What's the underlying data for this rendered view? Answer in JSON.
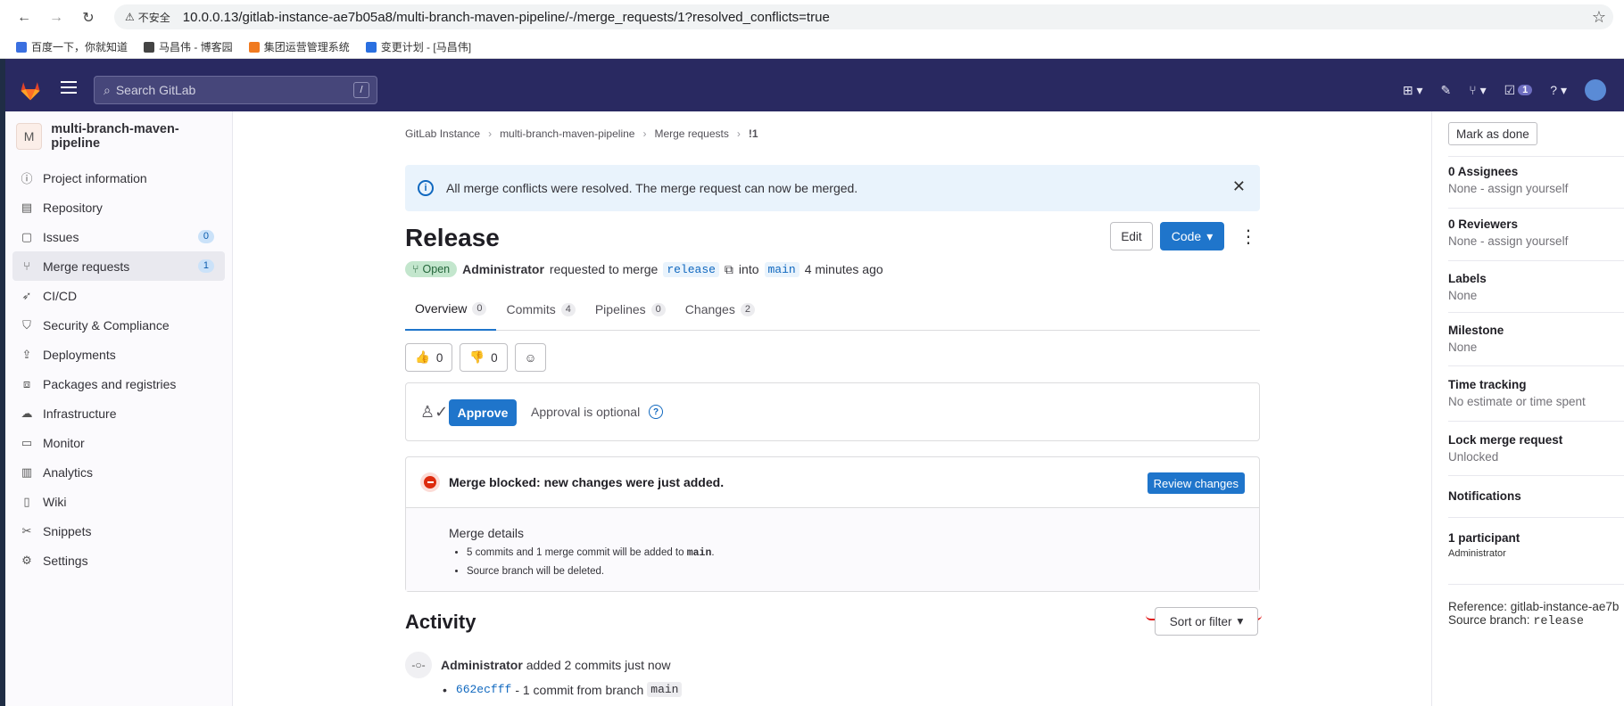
{
  "browser": {
    "insecure_label": "不安全",
    "url": "10.0.0.13/gitlab-instance-ae7b05a8/multi-branch-maven-pipeline/-/merge_requests/1?resolved_conflicts=true",
    "bookmarks": [
      "百度一下，你就知道",
      "马昌伟 - 博客园",
      "集团运营管理系统",
      "变更计划 - [马昌伟]"
    ]
  },
  "topbar": {
    "search_placeholder": "Search GitLab",
    "search_shortcut": "/",
    "todo_count": "1"
  },
  "sidebar": {
    "project_avatar": "M",
    "project_name": "multi-branch-maven-pipeline",
    "items": [
      {
        "label": "Project information",
        "icon": "info-icon"
      },
      {
        "label": "Repository",
        "icon": "doc-icon"
      },
      {
        "label": "Issues",
        "icon": "issues-icon",
        "badge": "0"
      },
      {
        "label": "Merge requests",
        "icon": "merge-request-icon",
        "badge": "1"
      },
      {
        "label": "CI/CD",
        "icon": "rocket-icon"
      },
      {
        "label": "Security & Compliance",
        "icon": "shield-icon"
      },
      {
        "label": "Deployments",
        "icon": "deployments-icon"
      },
      {
        "label": "Packages and registries",
        "icon": "package-icon"
      },
      {
        "label": "Infrastructure",
        "icon": "cloud-icon"
      },
      {
        "label": "Monitor",
        "icon": "monitor-icon"
      },
      {
        "label": "Analytics",
        "icon": "chart-icon"
      },
      {
        "label": "Wiki",
        "icon": "book-icon"
      },
      {
        "label": "Snippets",
        "icon": "scissors-icon"
      },
      {
        "label": "Settings",
        "icon": "gear-icon"
      }
    ]
  },
  "breadcrumbs": [
    "GitLab Instance",
    "multi-branch-maven-pipeline",
    "Merge requests",
    "!1"
  ],
  "alert": {
    "text": "All merge conflicts were resolved. The merge request can now be merged."
  },
  "mr": {
    "title": "Release",
    "edit_label": "Edit",
    "code_label": "Code",
    "status": "Open",
    "author": "Administrator",
    "requested_text": "requested to merge",
    "source_branch": "release",
    "into_text": "into",
    "target_branch": "main",
    "time_ago": "4 minutes ago"
  },
  "tabs": [
    {
      "label": "Overview",
      "count": "0"
    },
    {
      "label": "Commits",
      "count": "4"
    },
    {
      "label": "Pipelines",
      "count": "0"
    },
    {
      "label": "Changes",
      "count": "2"
    }
  ],
  "awards": {
    "thumbs_up": "0",
    "thumbs_down": "0"
  },
  "approval": {
    "button": "Approve",
    "text": "Approval is optional"
  },
  "merge": {
    "blocked_text": "Merge blocked: new changes were just added.",
    "review_button": "Review changes",
    "details_title": "Merge details",
    "detail1_pre": "5 commits and 1 merge commit will be added to",
    "detail1_code": "main",
    "detail1_post": ".",
    "detail2": "Source branch will be deleted."
  },
  "activity": {
    "title": "Activity",
    "sort_label": "Sort or filter",
    "author": "Administrator",
    "action": "added 2 commits just now",
    "sha": "662ecfff",
    "commit_text": "- 1 commit from branch",
    "branch": "main"
  },
  "right_sidebar": {
    "mark_done": "Mark as done",
    "assignees_title": "0 Assignees",
    "assignees_value": "None - assign yourself",
    "reviewers_title": "0 Reviewers",
    "reviewers_value": "None - assign yourself",
    "labels_title": "Labels",
    "labels_value": "None",
    "milestone_title": "Milestone",
    "milestone_value": "None",
    "time_title": "Time tracking",
    "time_value": "No estimate or time spent",
    "lock_title": "Lock merge request",
    "lock_value": "Unlocked",
    "notifications_title": "Notifications",
    "participants_title": "1 participant",
    "participant_name": "Administrator",
    "reference": "Reference: gitlab-instance-ae7b",
    "source_branch_label": "Source branch:",
    "source_branch_value": "release"
  }
}
